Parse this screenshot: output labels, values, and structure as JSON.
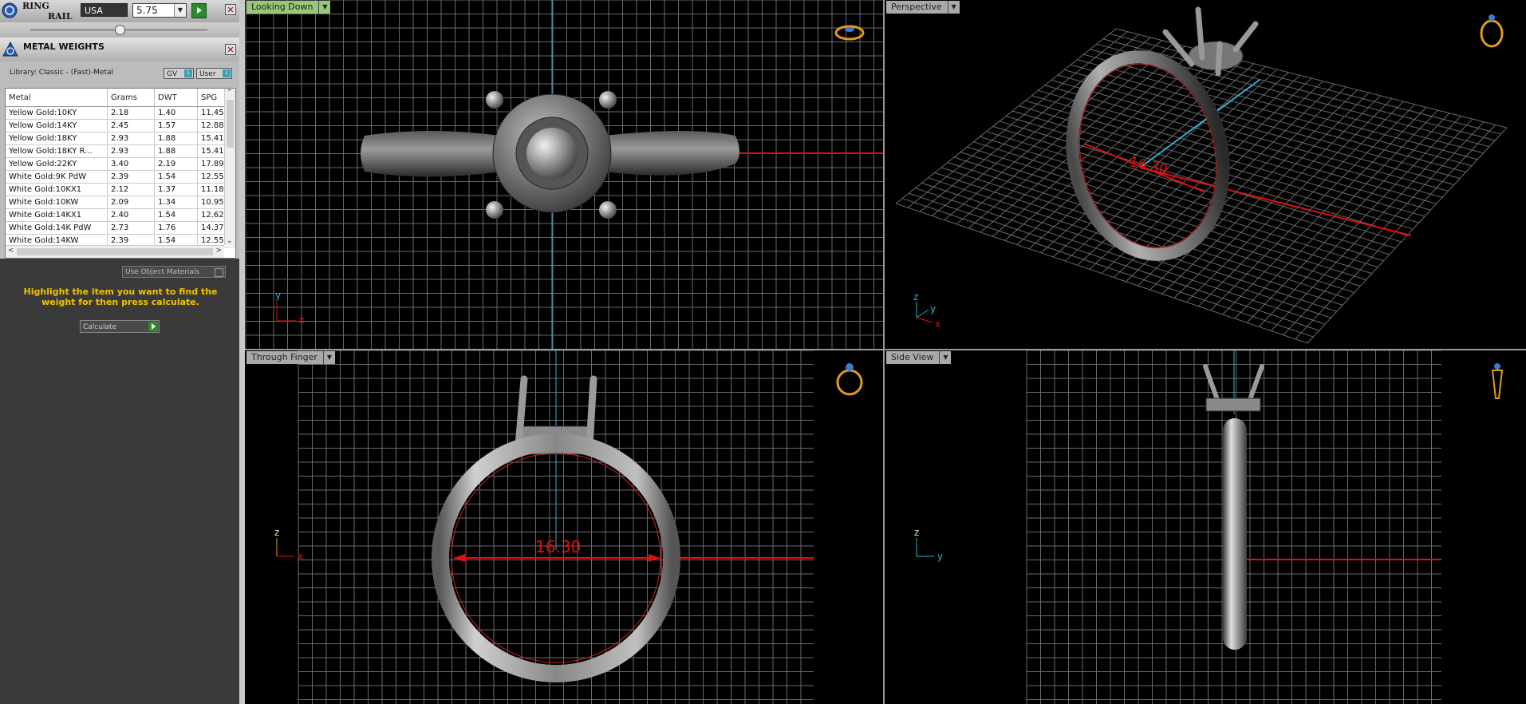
{
  "ring_rail": {
    "title_line1": "RING",
    "title_line2": "RAIL",
    "country": "USA",
    "size": "5.75",
    "close": "✕"
  },
  "metal_weights": {
    "title": "METAL WEIGHTS",
    "close": "✕",
    "library": "Library: Classic - (Fast)-Metal",
    "gv_label": "GV",
    "user_label": "User",
    "columns": [
      "Metal",
      "Grams",
      "DWT",
      "SPG"
    ],
    "rows": [
      {
        "metal": "Yellow Gold:10KY",
        "grams": "2.18",
        "dwt": "1.40",
        "spg": "11.45"
      },
      {
        "metal": "Yellow Gold:14KY",
        "grams": "2.45",
        "dwt": "1.57",
        "spg": "12.88"
      },
      {
        "metal": "Yellow Gold:18KY",
        "grams": "2.93",
        "dwt": "1.88",
        "spg": "15.41"
      },
      {
        "metal": "Yellow Gold:18KY R...",
        "grams": "2.93",
        "dwt": "1.88",
        "spg": "15.41"
      },
      {
        "metal": "Yellow Gold:22KY",
        "grams": "3.40",
        "dwt": "2.19",
        "spg": "17.89"
      },
      {
        "metal": "White Gold:9K PdW",
        "grams": "2.39",
        "dwt": "1.54",
        "spg": "12.55"
      },
      {
        "metal": "White Gold:10KX1",
        "grams": "2.12",
        "dwt": "1.37",
        "spg": "11.18"
      },
      {
        "metal": "White Gold:10KW",
        "grams": "2.09",
        "dwt": "1.34",
        "spg": "10.95"
      },
      {
        "metal": "White Gold:14KX1",
        "grams": "2.40",
        "dwt": "1.54",
        "spg": "12.62"
      },
      {
        "metal": "White Gold:14K PdW",
        "grams": "2.73",
        "dwt": "1.76",
        "spg": "14.37"
      },
      {
        "metal": "White Gold:14KW",
        "grams": "2.39",
        "dwt": "1.54",
        "spg": "12.55"
      }
    ],
    "use_object_materials": "Use Object Materials",
    "hint": "Highlight the item you want to find the weight for then press calculate.",
    "calculate": "Calculate"
  },
  "viewports": {
    "top": {
      "label": "Looking Down",
      "axis1": "y",
      "axis2": "x"
    },
    "perspective": {
      "label": "Perspective",
      "dimension": "16.30",
      "axis_z": "z",
      "axis_y": "y",
      "axis_x": "x"
    },
    "front": {
      "label": "Through Finger",
      "dimension": "16.30",
      "axis1": "z",
      "axis2": "x"
    },
    "side": {
      "label": "Side View",
      "axis1": "z",
      "axis2": "y"
    }
  },
  "colors": {
    "grid": "#6a6a6a",
    "axis_cyan": "#2bb3d4",
    "dimension_red": "#e01010",
    "hint_yellow": "#f2c300",
    "label_green": "#98c67a"
  }
}
